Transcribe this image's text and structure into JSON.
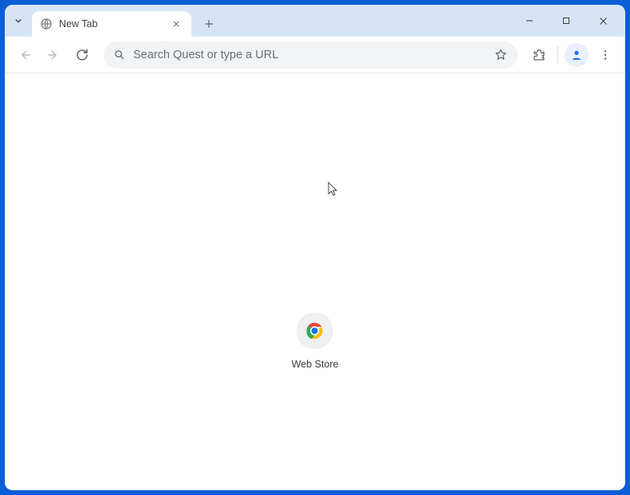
{
  "tab": {
    "title": "New Tab"
  },
  "omnibox": {
    "placeholder": "Search Quest or type a URL"
  },
  "shortcuts": [
    {
      "label": "Web Store"
    }
  ]
}
